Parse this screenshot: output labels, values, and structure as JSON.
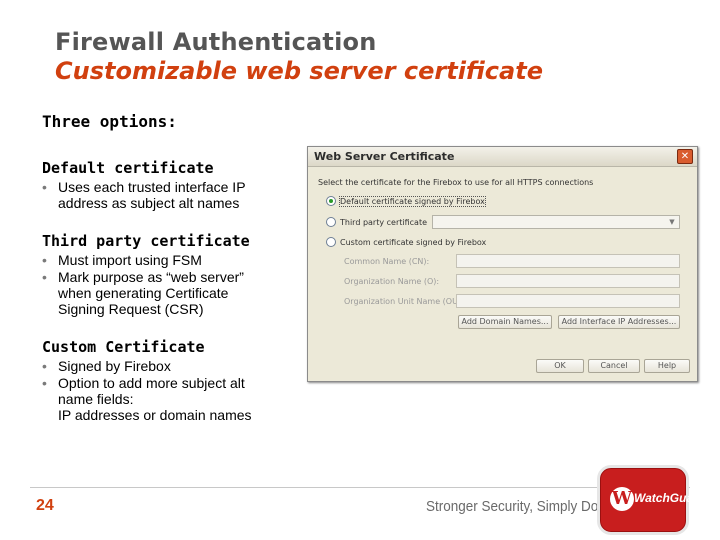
{
  "slide": {
    "title_line1": "Firewall Authentication",
    "title_line2": "Customizable web server certificate",
    "subtitle": "Three options:",
    "sections": [
      {
        "heading": "Default certificate",
        "bullets": [
          {
            "line1": "Uses each trusted interface IP",
            "cont": [
              "address as subject alt names"
            ]
          }
        ]
      },
      {
        "heading": "Third party certificate",
        "bullets": [
          {
            "line1": "Must import using FSM",
            "cont": []
          },
          {
            "line1": "Mark purpose as “web server”",
            "cont": [
              "when generating Certificate",
              "Signing Request (CSR)"
            ]
          }
        ]
      },
      {
        "heading": "Custom Certificate",
        "bullets": [
          {
            "line1": "Signed by Firebox",
            "cont": []
          },
          {
            "line1": "Option to add more subject alt",
            "cont": [
              "name fields:",
              "IP addresses or domain names"
            ]
          }
        ]
      }
    ],
    "page_number": "24",
    "tagline": "Stronger Security, Simply Done™",
    "logo_text": "WatchGuard®",
    "logo_mark": "W"
  },
  "dialog": {
    "title": "Web Server Certificate",
    "close_glyph": "✕",
    "instruction": "Select the certificate for the Firebox to use for all HTTPS connections",
    "options": [
      {
        "label": "Default certificate signed by Firebox",
        "selected": true
      },
      {
        "label": "Third party certificate",
        "selected": false
      },
      {
        "label": "Custom certificate signed by Firebox",
        "selected": false
      }
    ],
    "third_party_select_value": "",
    "fields": [
      {
        "label": "Common Name (CN):",
        "value": ""
      },
      {
        "label": "Organization Name (O):",
        "value": ""
      },
      {
        "label": "Organization Unit Name (OU):",
        "value": ""
      }
    ],
    "add_domain_button": "Add Domain Names...",
    "add_interface_button": "Add Interface IP Addresses...",
    "ok_button": "OK",
    "cancel_button": "Cancel",
    "help_button": "Help"
  },
  "colors": {
    "accent_orange": "#d1400f",
    "title_gray": "#555555",
    "logo_red": "#c81e1e"
  }
}
